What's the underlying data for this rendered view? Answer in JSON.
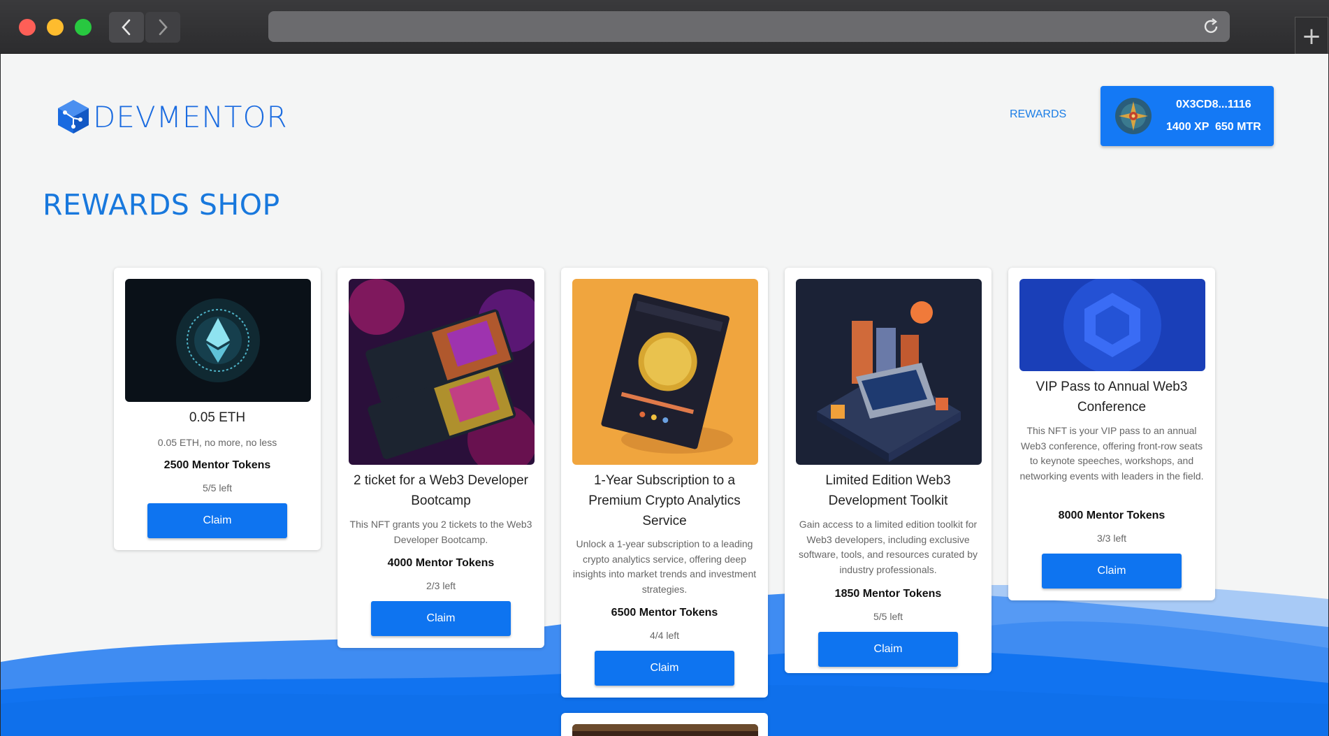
{
  "browser": {
    "back_icon": "chevron-left-icon",
    "forward_icon": "chevron-right-icon",
    "reload_icon": "reload-icon",
    "new_tab_label": "+"
  },
  "header": {
    "logo_text": "DEVMENTOR",
    "logo_icon": "devmentor-cube-icon",
    "nav_rewards": "REWARDS",
    "wallet": {
      "address": "0X3CD8...1116",
      "stats": "1400 XP  650 MTR"
    }
  },
  "page": {
    "title": "REWARDS SHOP"
  },
  "rewards": [
    {
      "title": "0.05 ETH",
      "description": "0.05 ETH, no more, no less",
      "price": "2500 Mentor Tokens",
      "left": "5/5 left",
      "button": "Claim"
    },
    {
      "title": "2 ticket for a Web3 Developer Bootcamp",
      "description": "This NFT grants you 2 tickets to the Web3 Developer Bootcamp.",
      "price": "4000 Mentor Tokens",
      "left": "2/3 left",
      "button": "Claim"
    },
    {
      "title": "1-Year Subscription to a Premium Crypto Analytics Service",
      "description": "Unlock a 1-year subscription to a leading crypto analytics service, offering deep insights into market trends and investment strategies.",
      "price": "6500 Mentor Tokens",
      "left": "4/4 left",
      "button": "Claim"
    },
    {
      "title": "Limited Edition Web3 Development Toolkit",
      "description": "Gain access to a limited edition toolkit for Web3 developers, including exclusive software, tools, and resources curated by industry professionals.",
      "price": "1850 Mentor Tokens",
      "left": "5/5 left",
      "button": "Claim"
    },
    {
      "title": "VIP Pass to Annual Web3 Conference",
      "description": "This NFT is your VIP pass to an annual Web3 conference, offering front-row seats to keynote speeches, workshops, and networking events with leaders in the field.",
      "price": "8000 Mentor Tokens",
      "left": "3/3 left",
      "button": "Claim"
    }
  ],
  "colors": {
    "accent": "#0e74f0",
    "title_blue": "#1878dd",
    "background": "#f4f5f5"
  }
}
